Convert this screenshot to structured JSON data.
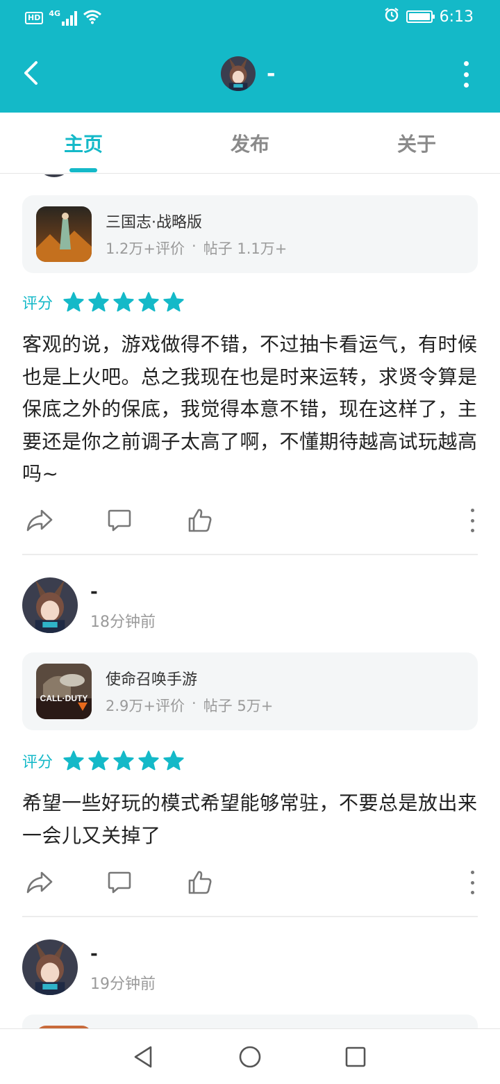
{
  "status_bar": {
    "time": "6:13",
    "network": "4G",
    "hd": "HD"
  },
  "app_bar": {
    "title": "-"
  },
  "tabs": [
    {
      "label": "主页",
      "active": true
    },
    {
      "label": "发布",
      "active": false
    },
    {
      "label": "关于",
      "active": false
    }
  ],
  "posts": [
    {
      "game": {
        "name": "三国志·战略版",
        "reviews": "1.2万+评价",
        "separator": "·",
        "posts": "帖子 1.1万+"
      },
      "rating_label": "评分",
      "stars": 5,
      "text": "客观的说，游戏做得不错，不过抽卡看运气，有时候也是上火吧。总之我现在也是时来运转，求贤令算是保底之外的保底，我觉得本意不错，现在这样了，主要还是你之前调子太高了啊，不懂期待越高试玩越高吗~"
    },
    {
      "author": {
        "name": "-",
        "time": "18分钟前"
      },
      "game": {
        "name": "使命召唤手游",
        "reviews": "2.9万+评价",
        "separator": "·",
        "posts": "帖子 5万+"
      },
      "rating_label": "评分",
      "stars": 5,
      "text": "希望一些好玩的模式希望能够常驻，不要总是放出来一会儿又关掉了"
    },
    {
      "author": {
        "name": "-",
        "time": "19分钟前"
      }
    }
  ],
  "icons": {
    "back": "chevron-left-icon",
    "menu": "more-vertical-icon",
    "share": "share-icon",
    "comment": "comment-icon",
    "like": "thumbs-up-icon"
  },
  "colors": {
    "accent": "#14b9c8",
    "card_bg": "#f4f6f7",
    "muted": "#9a9a9a"
  }
}
